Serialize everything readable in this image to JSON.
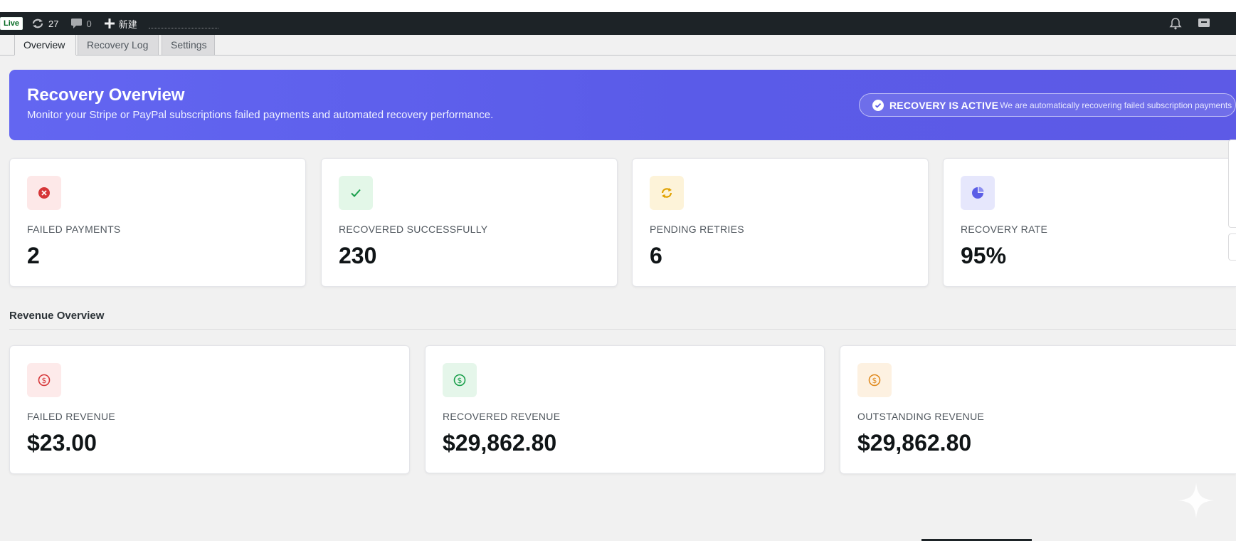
{
  "admin_bar": {
    "live_badge": "Live",
    "updates_count": "27",
    "comments_count": "0",
    "new_label": "新建",
    "icons": [
      "updates-icon",
      "comment-icon",
      "plus-icon",
      "bell-icon",
      "inbox-icon"
    ]
  },
  "tabs": [
    {
      "label": "Overview",
      "active": true
    },
    {
      "label": "Recovery Log",
      "active": false
    },
    {
      "label": "Settings",
      "active": false
    }
  ],
  "hero": {
    "title": "Recovery Overview",
    "subtitle": "Monitor your Stripe or PayPal subscriptions failed payments and automated recovery performance.",
    "status_label": "RECOVERY IS ACTIVE",
    "status_desc": "We are automatically recovering failed subscription payments"
  },
  "stats": [
    {
      "label": "FAILED PAYMENTS",
      "value": "2",
      "icon": "x-circle-icon",
      "color": "#d63638",
      "bg": "#fde8e8"
    },
    {
      "label": "RECOVERED SUCCESSFULLY",
      "value": "230",
      "icon": "check-icon",
      "color": "#1a9f4b",
      "bg": "#e3f7e8"
    },
    {
      "label": "PENDING RETRIES",
      "value": "6",
      "icon": "refresh-icon",
      "color": "#e0a100",
      "bg": "#fdf3d9"
    },
    {
      "label": "RECOVERY RATE",
      "value": "95%",
      "icon": "pie-chart-icon",
      "color": "#5b5ee6",
      "bg": "#e6e7fc"
    }
  ],
  "revenue": {
    "section_title": "Revenue Overview",
    "cards": [
      {
        "label": "FAILED REVENUE",
        "value": "$23.00",
        "icon": "dollar-circle-icon",
        "color": "#d63638",
        "bg": "#fdeaea"
      },
      {
        "label": "RECOVERED REVENUE",
        "value": "$29,862.80",
        "icon": "dollar-circle-icon",
        "color": "#1a9f4b",
        "bg": "#e5f6ea"
      },
      {
        "label": "OUTSTANDING REVENUE",
        "value": "$29,862.80",
        "icon": "dollar-circle-icon",
        "color": "#e08a1e",
        "bg": "#fdf1e1"
      }
    ]
  },
  "colors": {
    "hero_gradient_start": "#6366f1",
    "hero_gradient_end": "#5a5be8",
    "admin_bar": "#1d2327"
  }
}
